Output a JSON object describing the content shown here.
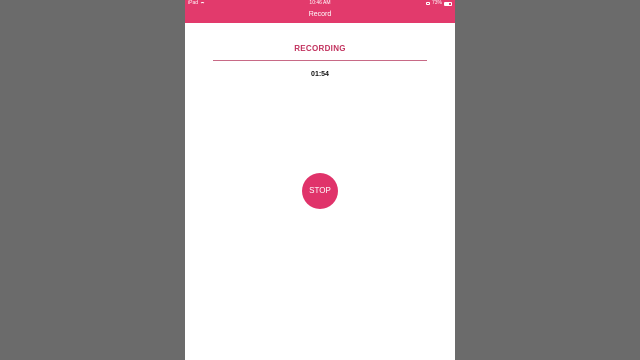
{
  "status_bar": {
    "device": "iPad",
    "time": "10:46 AM",
    "battery": "73%"
  },
  "nav": {
    "title": "Record"
  },
  "recording": {
    "heading": "RECORDING",
    "elapsed": "01:54",
    "stop_label": "STOP"
  },
  "colors": {
    "accent": "#e23a6c",
    "heading": "#c2325e",
    "stop_button": "#e0336a"
  },
  "icons": [
    "wifi-icon",
    "lock-icon",
    "battery-icon"
  ]
}
